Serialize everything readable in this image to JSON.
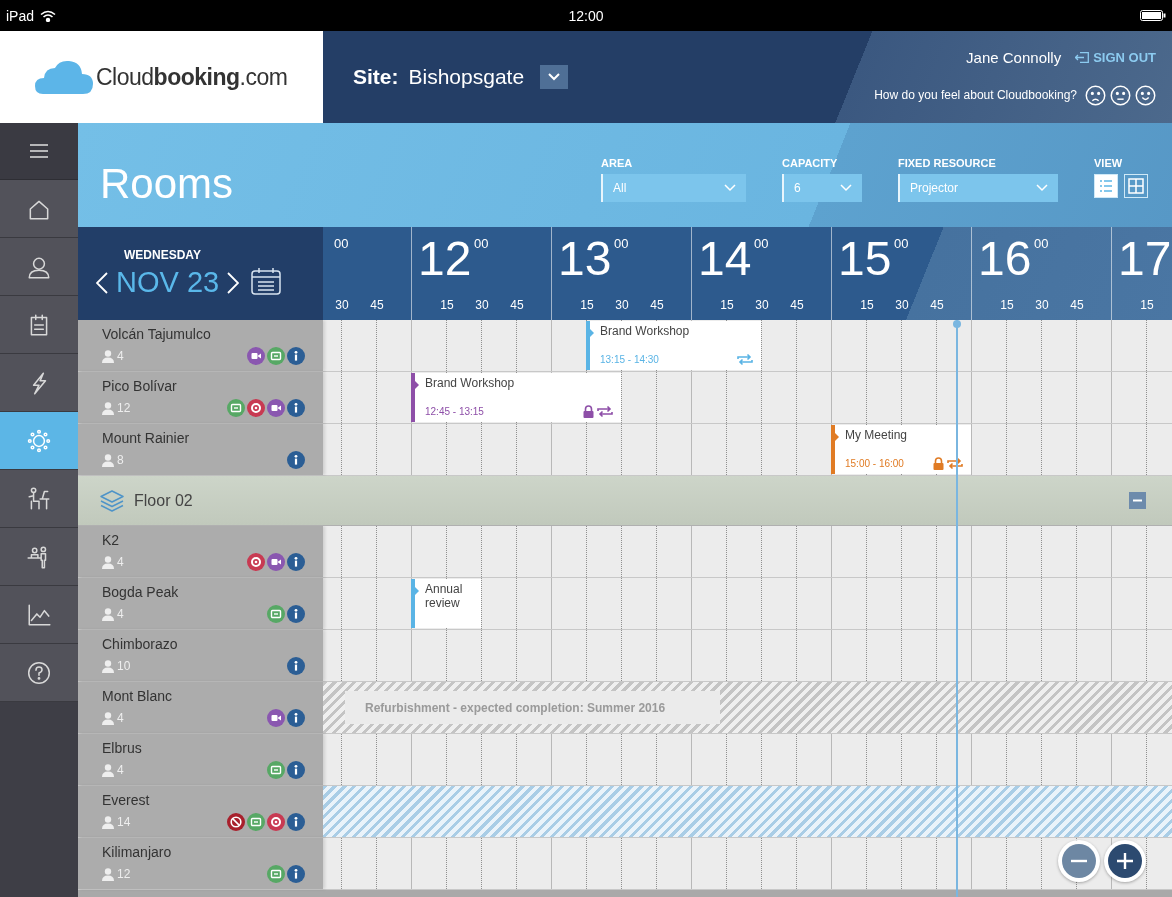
{
  "status_bar": {
    "device": "iPad",
    "time": "12:00"
  },
  "header": {
    "logo": "Cloud**booking**.com",
    "site_label": "Site:",
    "site": "Bishopsgate",
    "user": "Jane Connolly",
    "sign_out": "SIGN OUT",
    "feedback_question": "How do you feel about Cloudbooking?"
  },
  "sidebar": {
    "items": [
      {
        "selected": false
      },
      {
        "selected": false
      },
      {
        "selected": false
      },
      {
        "selected": false
      },
      {
        "selected": true
      },
      {
        "selected": false
      },
      {
        "selected": false
      },
      {
        "selected": false
      },
      {
        "selected": false
      }
    ]
  },
  "page_title": "Rooms",
  "filters": [
    {
      "label": "AREA",
      "value": "All"
    },
    {
      "label": "CAPACITY",
      "value": "6"
    },
    {
      "label": "FIXED RESOURCE",
      "value": "Projector"
    }
  ],
  "view": {
    "label": "VIEW",
    "options": [
      {
        "selected": true
      },
      {
        "selected": false
      }
    ]
  },
  "date": {
    "weekday": "WEDNESDAY",
    "date": "NOV 23"
  },
  "time_header": [
    {
      "minutes": "00",
      "quarters": [
        "30",
        "45"
      ]
    },
    {
      "hour": "12",
      "minutes": "00",
      "quarters": [
        "15",
        "30",
        "45"
      ]
    },
    {
      "hour": "13",
      "minutes": "00",
      "quarters": [
        "15",
        "30",
        "45"
      ]
    },
    {
      "hour": "14",
      "minutes": "00",
      "quarters": [
        "15",
        "30",
        "45"
      ]
    },
    {
      "hour": "15",
      "minutes": "00",
      "quarters": [
        "15",
        "30",
        "45"
      ]
    },
    {
      "hour": "16",
      "minutes": "00",
      "quarters": [
        "15",
        "30",
        "45"
      ]
    },
    {
      "hour": "17",
      "quarters": [
        "15"
      ]
    }
  ],
  "groups": [
    {
      "rooms": [
        {
          "name": "Volcán Tajumulco",
          "capacity": "4",
          "features": [
            {
              "kind": "video"
            },
            {
              "kind": "screen"
            },
            {
              "kind": "info"
            }
          ],
          "events": [
            {
              "title": "Brand Workshop",
              "time": "13:15 - 14:30",
              "color": "#5ab4e5",
              "recurring": true
            }
          ]
        },
        {
          "name": "Pico Bolívar",
          "capacity": "12",
          "features": [
            {
              "kind": "screen"
            },
            {
              "kind": "target"
            },
            {
              "kind": "video"
            },
            {
              "kind": "info"
            }
          ],
          "events": [
            {
              "title": "Brand Workshop",
              "time": "12:45 - 13:15",
              "color": "#8e4fa8",
              "locked": true,
              "recurring": true
            }
          ]
        },
        {
          "name": "Mount Rainier",
          "capacity": "8",
          "features": [
            {
              "kind": "info"
            }
          ],
          "events": [
            {
              "title": "My Meeting",
              "time": "15:00 - 16:00",
              "color": "#e07b24",
              "locked": true,
              "recurring": true
            }
          ]
        }
      ]
    },
    {
      "label": "Floor 02",
      "expanded": true,
      "rooms": [
        {
          "name": "K2",
          "capacity": "4",
          "features": [
            {
              "kind": "target"
            },
            {
              "kind": "video"
            },
            {
              "kind": "info"
            }
          ]
        },
        {
          "name": "Bogda Peak",
          "capacity": "4",
          "features": [
            {
              "kind": "screen"
            },
            {
              "kind": "info"
            }
          ],
          "events": [
            {
              "title": "Annual review",
              "color": "#5ab4e5"
            }
          ]
        },
        {
          "name": "Chimborazo",
          "capacity": "10",
          "features": [
            {
              "kind": "info"
            }
          ]
        },
        {
          "name": "Mont Blanc",
          "capacity": "4",
          "features": [
            {
              "kind": "video"
            },
            {
              "kind": "info"
            }
          ],
          "block": {
            "kind": "refurbishment",
            "label": "Refurbishment - expected completion: Summer 2016"
          }
        },
        {
          "name": "Elbrus",
          "capacity": "4",
          "features": [
            {
              "kind": "screen"
            },
            {
              "kind": "info"
            }
          ]
        },
        {
          "name": "Everest",
          "capacity": "14",
          "features": [
            {
              "kind": "noentry"
            },
            {
              "kind": "screen"
            },
            {
              "kind": "target"
            },
            {
              "kind": "info"
            }
          ],
          "block": {
            "kind": "unavailable"
          }
        },
        {
          "name": "Kilimanjaro",
          "capacity": "12",
          "features": [
            {
              "kind": "screen"
            },
            {
              "kind": "info"
            }
          ]
        }
      ]
    }
  ],
  "zoom_controls": [
    {
      "kind": "out",
      "disabled": true
    },
    {
      "kind": "in",
      "disabled": false
    }
  ]
}
